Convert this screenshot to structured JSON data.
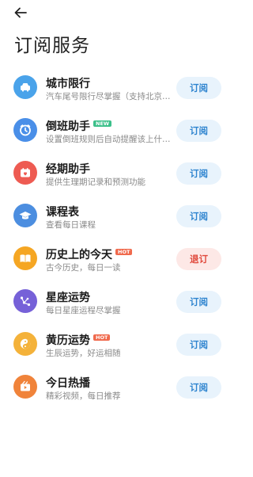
{
  "header": {
    "title": "订阅服务"
  },
  "items": [
    {
      "name": "城市限行",
      "badge": "",
      "desc": "汽车尾号限行尽掌握（支持北京…",
      "action": "订阅",
      "state": "sub",
      "icon": "car-icon",
      "color": "#4aa3ea"
    },
    {
      "name": "倒班助手",
      "badge": "NEW",
      "desc": "设置倒班规则后自动提醒该上什…",
      "action": "订阅",
      "state": "sub",
      "icon": "clock-icon",
      "color": "#4a8fe8"
    },
    {
      "name": "经期助手",
      "badge": "",
      "desc": "提供生理期记录和预测功能",
      "action": "订阅",
      "state": "sub",
      "icon": "calendar-heart-icon",
      "color": "#ee5b52"
    },
    {
      "name": "课程表",
      "badge": "",
      "desc": "查看每日课程",
      "action": "订阅",
      "state": "sub",
      "icon": "graduation-cap-icon",
      "color": "#4c8ee0"
    },
    {
      "name": "历史上的今天",
      "badge": "HOT",
      "desc": "古今历史，每日一读",
      "action": "退订",
      "state": "unsub",
      "icon": "book-icon",
      "color": "#f5a623"
    },
    {
      "name": "星座运势",
      "badge": "",
      "desc": "每日星座运程尽掌握",
      "action": "订阅",
      "state": "sub",
      "icon": "constellation-icon",
      "color": "#7661d8"
    },
    {
      "name": "黄历运势",
      "badge": "HOT",
      "desc": "生辰运势，好运相随",
      "action": "订阅",
      "state": "sub",
      "icon": "yin-yang-icon",
      "color": "#f4b23a"
    },
    {
      "name": "今日热播",
      "badge": "",
      "desc": "精彩视频，每日推荐",
      "action": "订阅",
      "state": "sub",
      "icon": "video-icon",
      "color": "#f0833a"
    }
  ]
}
